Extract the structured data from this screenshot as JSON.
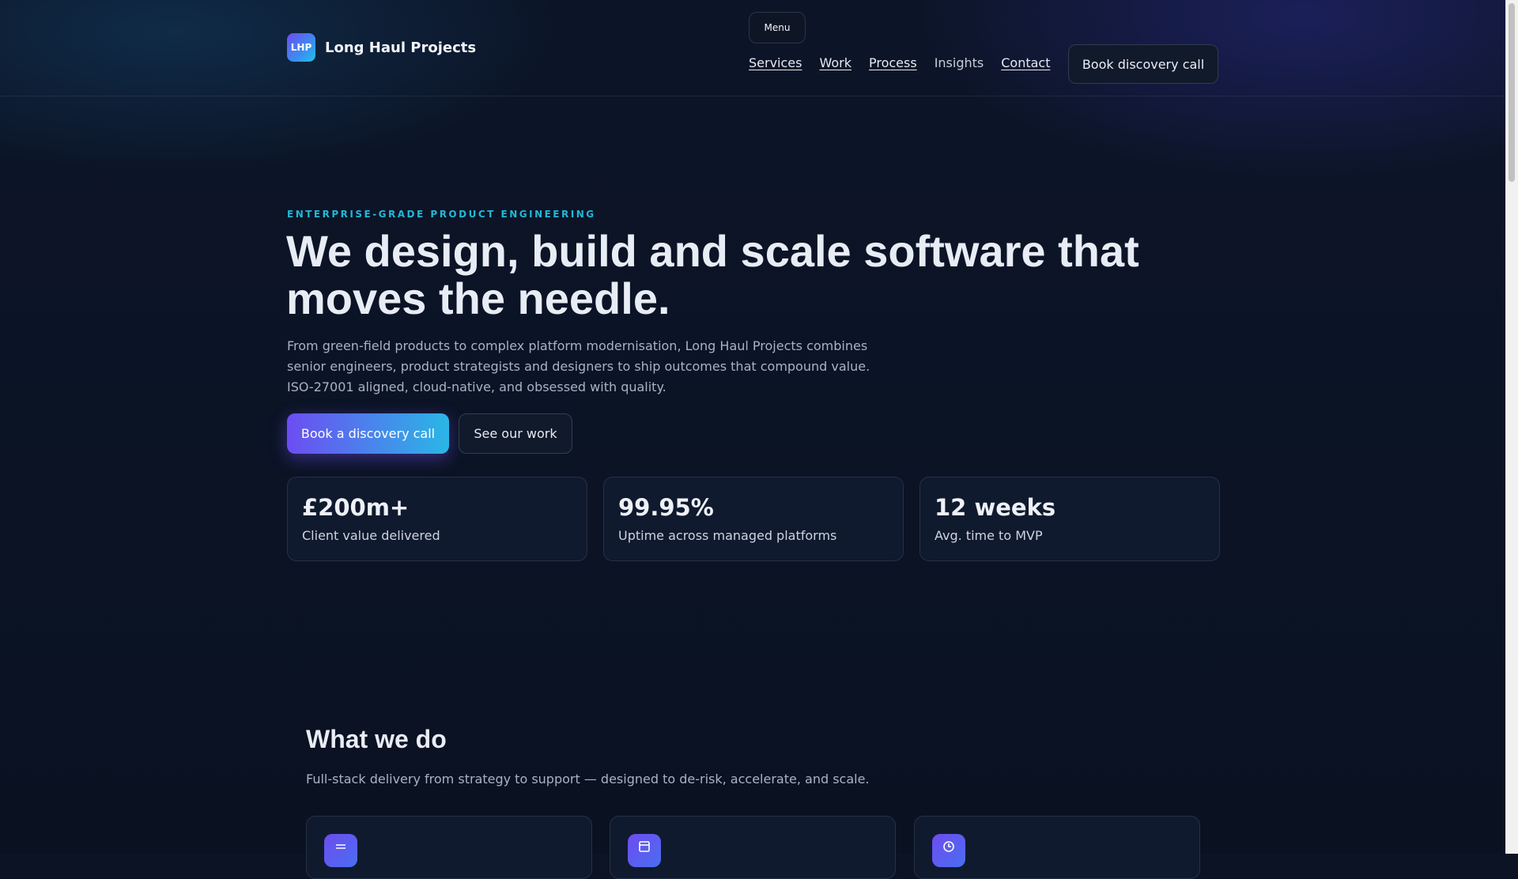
{
  "header": {
    "brand_mark": "LHP",
    "brand_name": "Long Haul Projects",
    "menu_label": "Menu",
    "nav": [
      {
        "label": "Services"
      },
      {
        "label": "Work"
      },
      {
        "label": "Process"
      },
      {
        "label": "Insights"
      },
      {
        "label": "Contact"
      }
    ],
    "cta_label": "Book discovery call"
  },
  "hero": {
    "eyebrow": "ENTERPRISE-GRADE PRODUCT ENGINEERING",
    "title": "We design, build and scale software that moves the needle.",
    "subtitle": "From green-field products to complex platform modernisation, Long Haul Projects combines senior engineers, product strategists and designers to ship outcomes that compound value. ISO-27001 aligned, cloud-native, and obsessed with quality.",
    "primary_cta": "Book a discovery call",
    "secondary_cta": "See our work"
  },
  "stats": [
    {
      "value": "£200m+",
      "label": "Client value delivered"
    },
    {
      "value": "99.95%",
      "label": "Uptime across managed platforms"
    },
    {
      "value": "12 weeks",
      "label": "Avg. time to MVP"
    }
  ],
  "services": {
    "title": "What we do",
    "subtitle": "Full-stack delivery from strategy to support — designed to de-risk, accelerate, and scale.",
    "cards": [
      {
        "icon": "list-icon"
      },
      {
        "icon": "panel-icon"
      },
      {
        "icon": "clock-icon"
      }
    ]
  },
  "colors": {
    "background": "#0b1324",
    "accent_purple": "#6c4df2",
    "accent_cyan": "#22b8d8"
  }
}
